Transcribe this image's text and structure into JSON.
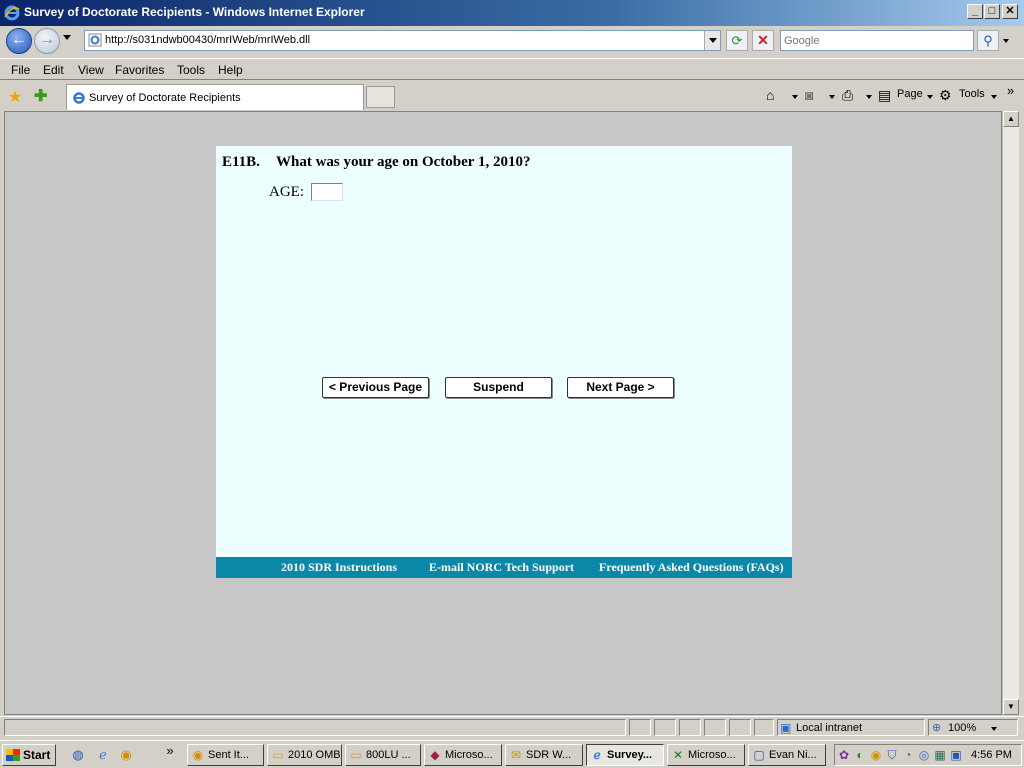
{
  "window": {
    "title": "Survey of Doctorate Recipients - Windows Internet Explorer",
    "minimize": "_",
    "maximize": "□",
    "close": "✕"
  },
  "address_bar": {
    "url": "http://s031ndwb00430/mrIWeb/mrIWeb.dll",
    "search_placeholder": "Google"
  },
  "menu": {
    "items": [
      "File",
      "Edit",
      "View",
      "Favorites",
      "Tools",
      "Help"
    ]
  },
  "tab": {
    "label": "Survey of Doctorate Recipients"
  },
  "command_bar": {
    "page_label": "Page",
    "tools_label": "Tools",
    "chevron": "»"
  },
  "survey": {
    "question_number": "E11B.",
    "question_text": "What was your age on October 1, 2010?",
    "age_label": "AGE:",
    "age_value": "",
    "buttons": {
      "previous": "< Previous Page",
      "suspend": "Suspend",
      "next": "Next Page >"
    },
    "footer": {
      "instructions": "2010 SDR Instructions",
      "email": "E-mail NORC Tech Support",
      "faq": "Frequently Asked Questions (FAQs)"
    },
    "colors": {
      "background": "#eeffff",
      "footer": "#0a88a8"
    }
  },
  "status_bar": {
    "zone": "Local intranet",
    "zoom": "100%"
  },
  "taskbar": {
    "start": "Start",
    "chevron": "»",
    "tasks": [
      {
        "label": "Sent It...",
        "icon": "outlook-icon"
      },
      {
        "label": "2010 OMB",
        "icon": "folder-icon"
      },
      {
        "label": "800LU ...",
        "icon": "folder-icon"
      },
      {
        "label": "Microso...",
        "icon": "access-icon"
      },
      {
        "label": "SDR W...",
        "icon": "mail-icon"
      },
      {
        "label": "Survey...",
        "icon": "ie-icon"
      },
      {
        "label": "Microso...",
        "icon": "excel-icon"
      },
      {
        "label": "Evan Ni...",
        "icon": "chat-icon"
      }
    ],
    "clock": "4:56 PM"
  }
}
